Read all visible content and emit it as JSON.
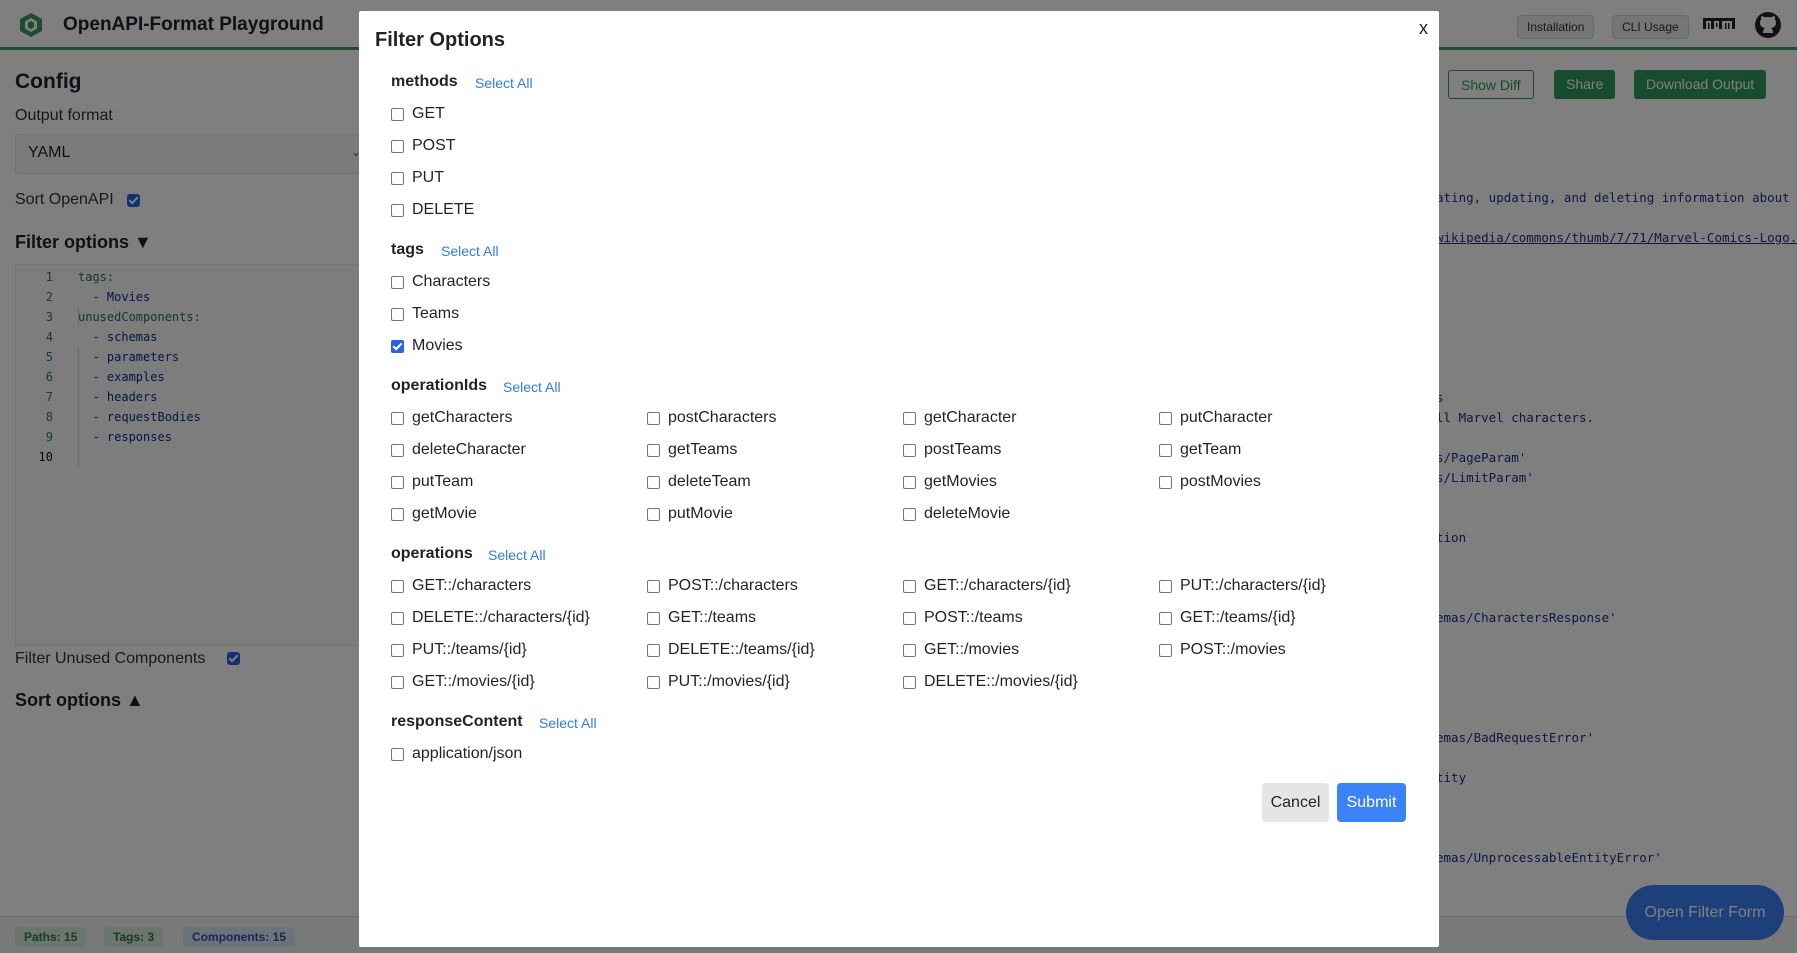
{
  "header": {
    "title": "OpenAPI-Format Playground",
    "installation_label": "Installation",
    "cli_usage_label": "CLI Usage"
  },
  "config": {
    "title": "Config",
    "output_format_label": "Output format",
    "output_format_value": "YAML",
    "sort_openapi_label": "Sort OpenAPI",
    "filter_options_label": "Filter options ▼",
    "editor_lines": [
      "tags:",
      "  - Movies",
      "unusedComponents:",
      "  - schemas",
      "  - parameters",
      "  - examples",
      "  - headers",
      "  - requestBodies",
      "  - responses",
      ""
    ],
    "filter_unused_label": "Filter Unused Components",
    "sort_options_label": "Sort options ▲"
  },
  "actions": {
    "show_diff": "Show Diff",
    "share": "Share",
    "download": "Download Output"
  },
  "output_fragments": [
    "ating, updating, and deleting information about",
    "wikipedia/commons/thumb/7/71/Marvel-Comics-Logo.",
    "s",
    "ll Marvel characters.",
    "s/PageParam'",
    "s/LimitParam'",
    "tion",
    "emas/CharactersResponse'",
    "emas/BadRequestError'",
    "tity",
    "emas/UnprocessableEntityError'"
  ],
  "footer": {
    "paths": "Paths: 15",
    "tags": "Tags: 3",
    "components": "Components: 15"
  },
  "open_filter_label": "Open Filter Form",
  "modal": {
    "title": "Filter Options",
    "close": "x",
    "select_all": "Select All",
    "groups": {
      "methods": {
        "title": "methods",
        "options": [
          "GET",
          "POST",
          "PUT",
          "DELETE"
        ]
      },
      "tags": {
        "title": "tags",
        "options": [
          "Characters",
          "Teams",
          "Movies"
        ],
        "checked": [
          "Movies"
        ]
      },
      "operationIds": {
        "title": "operationIds",
        "options": [
          "getCharacters",
          "postCharacters",
          "getCharacter",
          "putCharacter",
          "deleteCharacter",
          "getTeams",
          "postTeams",
          "getTeam",
          "putTeam",
          "deleteTeam",
          "getMovies",
          "postMovies",
          "getMovie",
          "putMovie",
          "deleteMovie"
        ]
      },
      "operations": {
        "title": "operations",
        "options": [
          "GET::/characters",
          "POST::/characters",
          "GET::/characters/{id}",
          "PUT::/characters/{id}",
          "DELETE::/characters/{id}",
          "GET::/teams",
          "POST::/teams",
          "GET::/teams/{id}",
          "PUT::/teams/{id}",
          "DELETE::/teams/{id}",
          "GET::/movies",
          "POST::/movies",
          "GET::/movies/{id}",
          "PUT::/movies/{id}",
          "DELETE::/movies/{id}"
        ]
      },
      "responseContent": {
        "title": "responseContent",
        "options": [
          "application/json"
        ]
      }
    },
    "cancel_label": "Cancel",
    "submit_label": "Submit"
  },
  "colors": {
    "brand_green": "#2f9a5a",
    "accent_blue": "#3b82f6",
    "link_blue": "#2f7de1"
  }
}
